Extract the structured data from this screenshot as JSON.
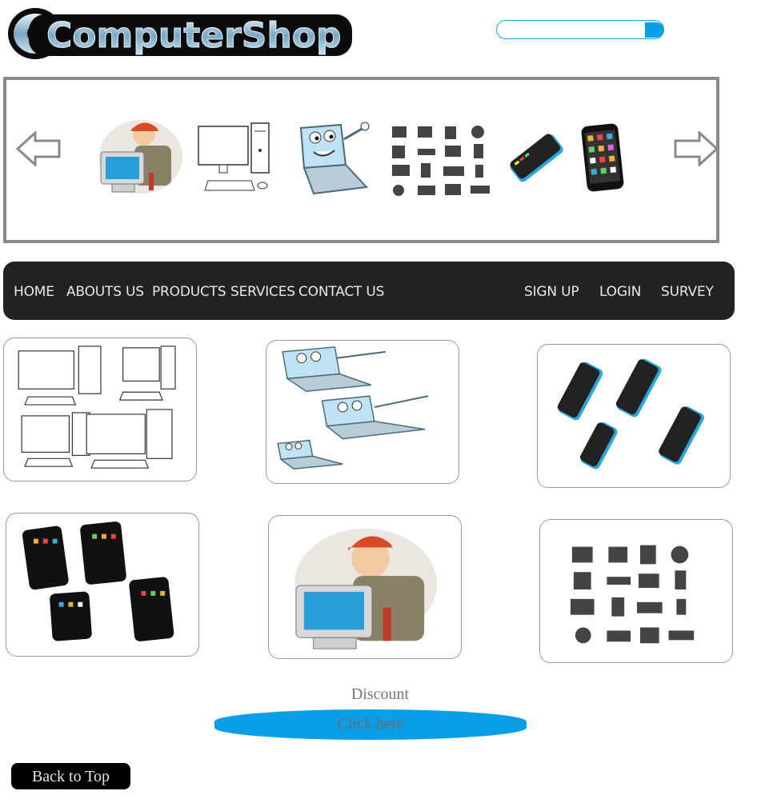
{
  "header": {
    "logo_text": "ComputerShop",
    "search_placeholder": ""
  },
  "carousel": {
    "items": [
      "technician",
      "desktop-pc",
      "laptop-mascot",
      "components-grid",
      "phone",
      "tablet"
    ]
  },
  "nav": {
    "home": "HOME",
    "about": "ABOUTS US",
    "products": "PRODUCTS",
    "services": "SERVICES",
    "contact": "CONTACT US",
    "signup": "SIGN UP",
    "login": "LOGIN",
    "survey": "SURVEY"
  },
  "products": [
    {
      "image": "desktop-computers"
    },
    {
      "image": "laptop-mascots"
    },
    {
      "image": "phones"
    },
    {
      "image": "tablets"
    },
    {
      "image": "technician"
    },
    {
      "image": "component-icons"
    }
  ],
  "promo": {
    "discount_label": "Discount",
    "button_label": "Click here"
  },
  "footer": {
    "back_to_top": "Back to Top"
  },
  "colors": {
    "accent": "#0a9ee9",
    "navbar": "#222222",
    "border": "#8a8a8a"
  }
}
